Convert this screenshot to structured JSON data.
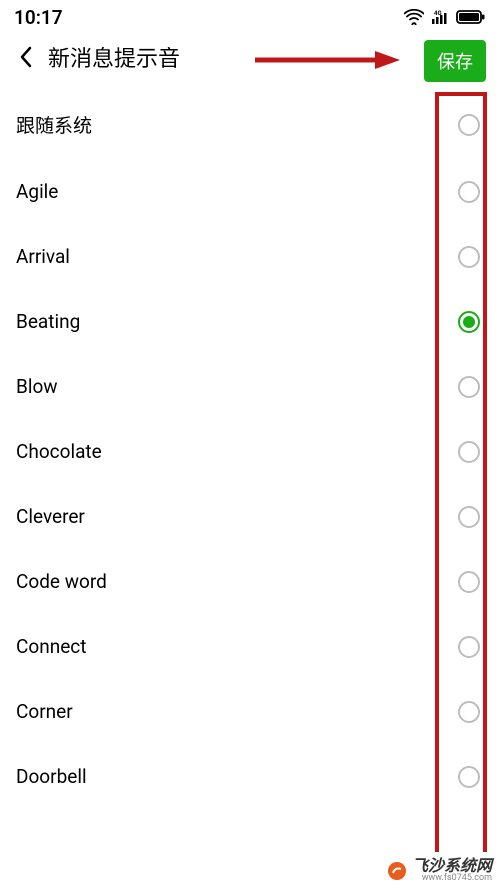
{
  "statusBar": {
    "time": "10:17"
  },
  "header": {
    "title": "新消息提示音",
    "saveLabel": "保存"
  },
  "selectedIndex": 3,
  "sounds": [
    {
      "label": "跟随系统"
    },
    {
      "label": "Agile"
    },
    {
      "label": "Arrival"
    },
    {
      "label": "Beating"
    },
    {
      "label": "Blow"
    },
    {
      "label": "Chocolate"
    },
    {
      "label": "Cleverer"
    },
    {
      "label": "Code word"
    },
    {
      "label": "Connect"
    },
    {
      "label": "Corner"
    },
    {
      "label": "Doorbell"
    }
  ],
  "watermark": {
    "main": "飞沙系统网",
    "sub": "www.fs0745.com"
  }
}
